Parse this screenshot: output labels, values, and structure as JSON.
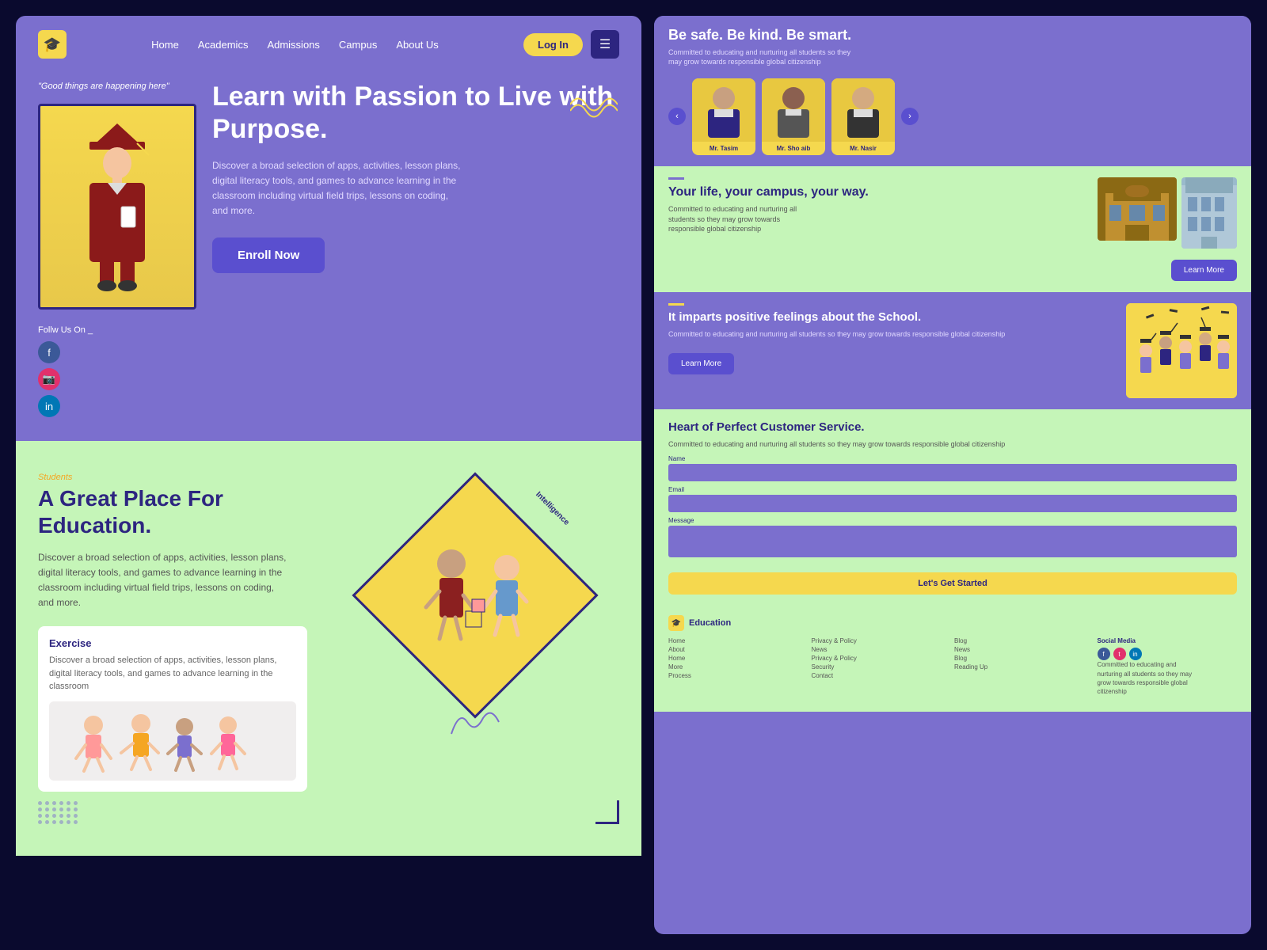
{
  "brand": {
    "name": "Education",
    "logo_symbol": "🎓"
  },
  "nav": {
    "links": [
      "Home",
      "Academics",
      "Admissions",
      "Campus",
      "About Us"
    ],
    "login_label": "Log In",
    "menu_icon": "☰"
  },
  "hero": {
    "quote": "\"Good things are happening here\"",
    "title": "Learn with Passion to Live with Purpose.",
    "description": "Discover a broad selection of apps, activities, lesson plans, digital literacy tools, and games to advance learning in the classroom including virtual field trips, lessons on coding, and more.",
    "cta_label": "Enroll Now",
    "social_label": "Follw Us On _",
    "social": [
      {
        "name": "Facebook",
        "icon": "f"
      },
      {
        "name": "Instagram",
        "icon": "📷"
      },
      {
        "name": "LinkedIn",
        "icon": "in"
      }
    ]
  },
  "students_section": {
    "label": "Students",
    "title": "A Great Place For Education.",
    "description": "Discover a broad selection of apps, activities, lesson plans, digital literacy tools, and games to advance learning in the classroom including virtual field trips, lessons on coding, and more.",
    "diamond_label": "Intelligence",
    "exercise": {
      "title": "Exercise",
      "description": "Discover a broad selection of apps, activities, lesson plans, digital literacy tools, and games to advance learning in the classroom"
    }
  },
  "right_panel": {
    "top_title": "Be safe. Be kind. Be smart.",
    "top_desc": "Committed to educating and nurturing all students so they may grow towards responsible global citizenship",
    "teachers": [
      {
        "name": "Mr. Tasim",
        "emoji": "👨‍💼"
      },
      {
        "name": "Mr. Sho aib",
        "emoji": "👨"
      },
      {
        "name": "Mr. Nasir",
        "emoji": "👨‍💻"
      }
    ],
    "campus": {
      "label": "Your life, your campus, your way.",
      "description": "Committed to educating and nurturing all students so they may grow towards responsible global citizenship",
      "learn_more": "Learn More"
    },
    "feelings": {
      "title": "It imparts positive feelings about the School.",
      "description": "Committed to educating and nurturing all students so they may grow towards responsible global citizenship",
      "learn_more": "Learn More"
    },
    "contact": {
      "title": "Heart of Perfect Customer Service.",
      "description": "Committed to educating and nurturing all students so they may grow towards responsible global citizenship",
      "form": {
        "name_label": "Name",
        "email_label": "Email",
        "message_label": "Message",
        "submit_label": "Let's Get Started"
      }
    },
    "footer": {
      "brand": "Education",
      "tagline": "Committed to educating and nurturing all students so they may grow towards responsible global citizenship",
      "columns": [
        {
          "title": "",
          "links": [
            "Home",
            "About",
            "Home",
            "More",
            "Process"
          ]
        },
        {
          "title": "",
          "links": [
            "Privacy & Policy",
            "News",
            "Privacy & Policy",
            "Security",
            "Contact"
          ]
        },
        {
          "title": "",
          "links": [
            "Blog",
            "News",
            "Blog",
            "Reading Up"
          ]
        }
      ],
      "social_title": "Social Media",
      "social_icons": [
        "f",
        "t",
        "in"
      ]
    }
  }
}
